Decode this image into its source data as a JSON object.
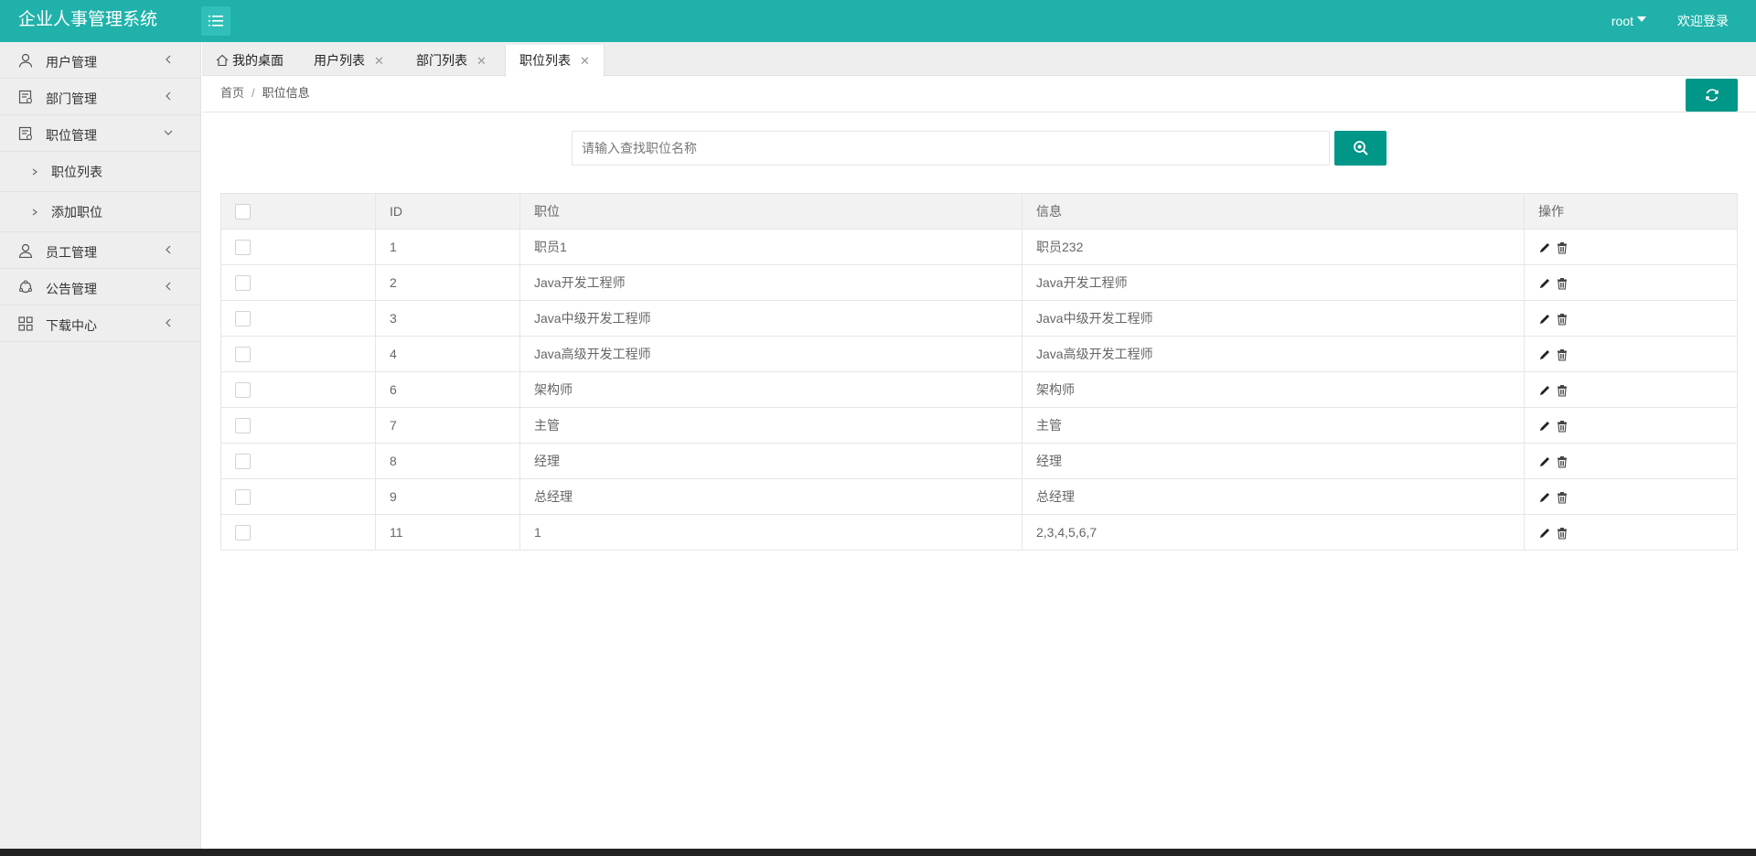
{
  "header": {
    "title": "企业人事管理系统",
    "user": "root",
    "welcome": "欢迎登录"
  },
  "sidebar": {
    "items": [
      {
        "label": "用户管理",
        "icon": "user-icon"
      },
      {
        "label": "部门管理",
        "icon": "department-icon"
      },
      {
        "label": "职位管理",
        "icon": "position-icon",
        "expanded": true,
        "children": [
          {
            "label": "职位列表"
          },
          {
            "label": "添加职位"
          }
        ]
      },
      {
        "label": "员工管理",
        "icon": "employee-icon"
      },
      {
        "label": "公告管理",
        "icon": "notice-icon"
      },
      {
        "label": "下载中心",
        "icon": "grid-icon"
      }
    ]
  },
  "tabs": [
    {
      "label": "我的桌面",
      "closable": false
    },
    {
      "label": "用户列表",
      "closable": true
    },
    {
      "label": "部门列表",
      "closable": true
    },
    {
      "label": "职位列表",
      "closable": true,
      "active": true
    }
  ],
  "breadcrumb": {
    "home": "首页",
    "separator": "/",
    "current": "职位信息"
  },
  "search": {
    "placeholder": "请输入查找职位名称"
  },
  "table": {
    "headers": [
      "ID",
      "职位",
      "信息",
      "操作"
    ],
    "rows": [
      {
        "id": "1",
        "name": "职员1",
        "info": "职员232"
      },
      {
        "id": "2",
        "name": "Java开发工程师",
        "info": "Java开发工程师"
      },
      {
        "id": "3",
        "name": "Java中级开发工程师",
        "info": "Java中级开发工程师"
      },
      {
        "id": "4",
        "name": "Java高级开发工程师",
        "info": "Java高级开发工程师"
      },
      {
        "id": "6",
        "name": "架构师",
        "info": "架构师"
      },
      {
        "id": "7",
        "name": "主管",
        "info": "主管"
      },
      {
        "id": "8",
        "name": "经理",
        "info": "经理"
      },
      {
        "id": "9",
        "name": "总经理",
        "info": "总经理"
      },
      {
        "id": "11",
        "name": "1",
        "info": "2,3,4,5,6,7"
      }
    ]
  },
  "colors": {
    "header": "#20b2aa",
    "primary_button": "#009688",
    "sidebar_bg": "#eeeeee"
  }
}
